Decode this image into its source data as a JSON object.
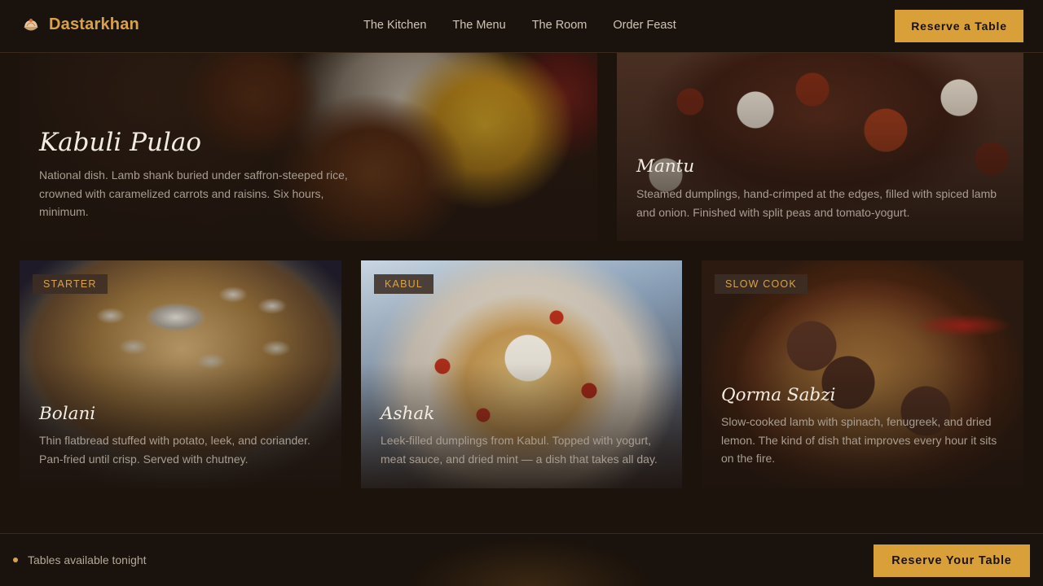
{
  "header": {
    "brand": "Dastarkhan",
    "brand_icon": "dumpling-icon",
    "nav": [
      "The Kitchen",
      "The Menu",
      "The Room",
      "Order Feast"
    ],
    "reserve_label": "Reserve a Table"
  },
  "cards": [
    {
      "title": "Kabuli Pulao",
      "desc": "National dish. Lamb shank buried under saffron-steeped rice, crowned with caramelized carrots and raisins. Six hours, minimum."
    },
    {
      "title": "Mantu",
      "desc": "Steamed dumplings, hand-crimped at the edges, filled with spiced lamb and onion. Finished with split peas and tomato-yogurt."
    },
    {
      "tag": "STARTER",
      "title": "Bolani",
      "desc": "Thin flatbread stuffed with potato, leek, and coriander. Pan-fried until crisp. Served with chutney."
    },
    {
      "tag": "KABUL",
      "title": "Ashak",
      "desc": "Leek-filled dumplings from Kabul. Topped with yogurt, meat sauce, and dried mint — a dish that takes all day."
    },
    {
      "tag": "SLOW COOK",
      "title": "Qorma Sabzi",
      "desc": "Slow-cooked lamb with spinach, fenugreek, and dried lemon. The kind of dish that improves every hour it sits on the fire."
    }
  ],
  "bottom_bar": {
    "status": "Tables available tonight",
    "reserve_label": "Reserve Your Table"
  },
  "colors": {
    "accent": "#d9a03a",
    "background": "#1c130d"
  }
}
